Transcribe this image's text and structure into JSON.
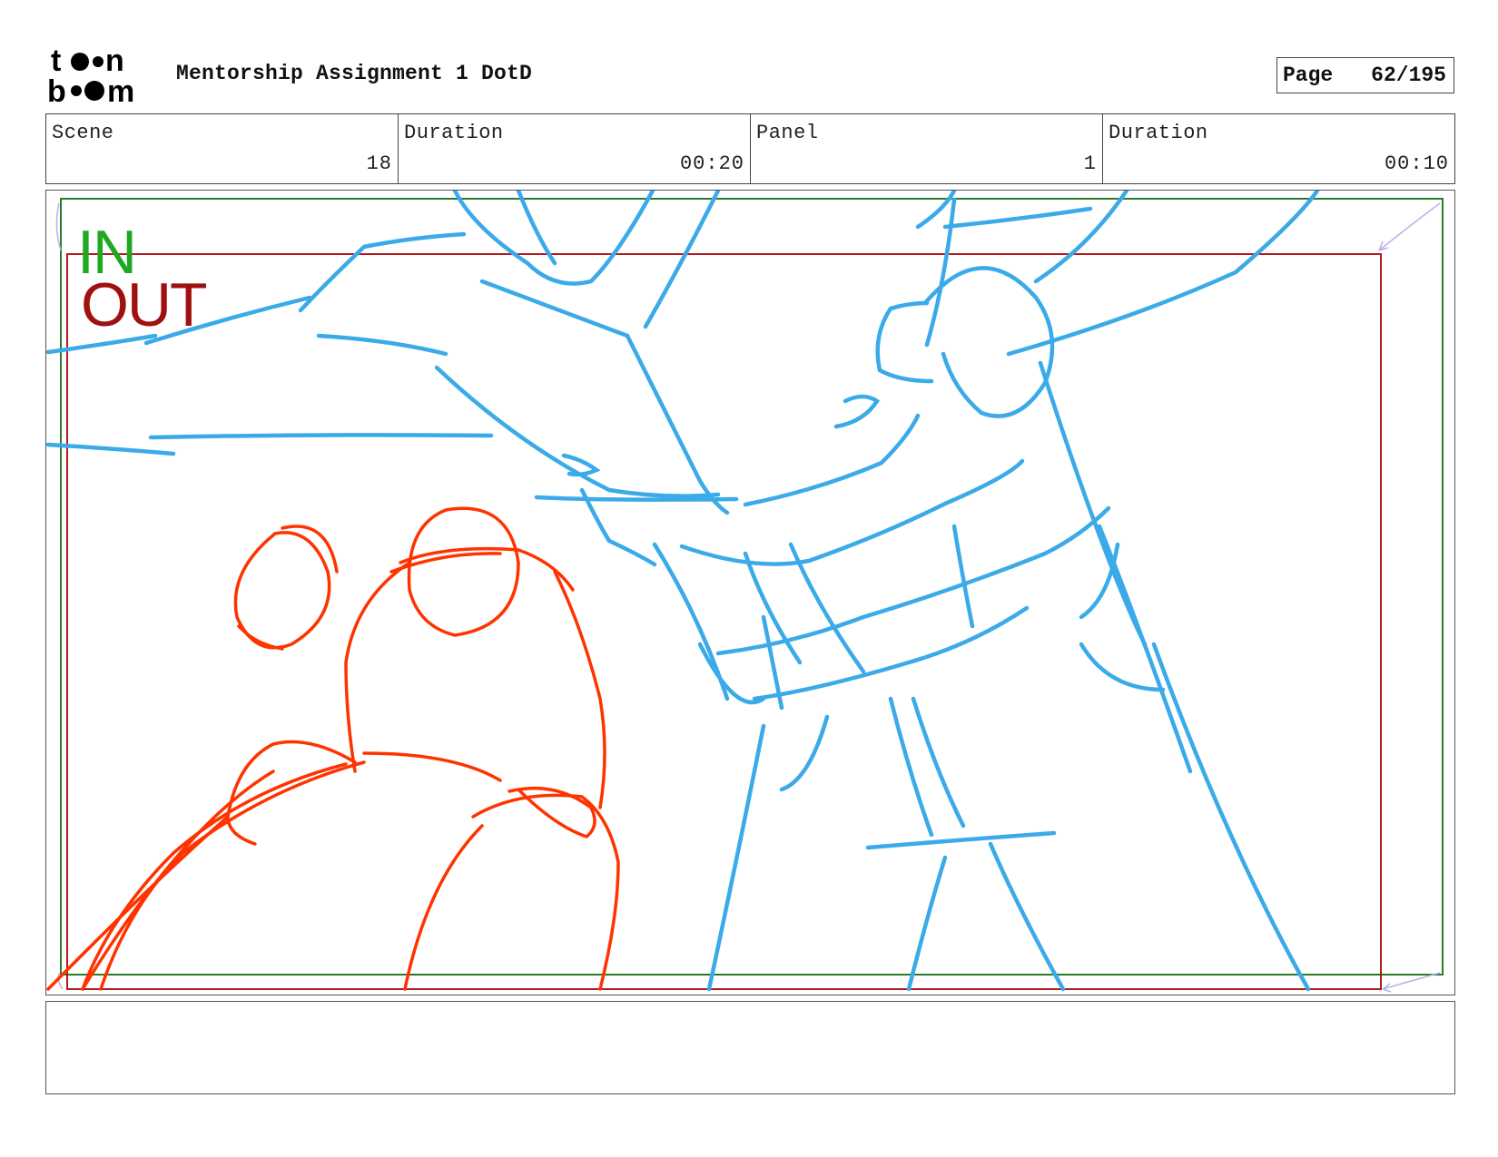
{
  "header": {
    "title": "Mentorship Assignment 1 DotD",
    "page_label": "Page",
    "page_value": "62/195"
  },
  "info": {
    "scene_label": "Scene",
    "scene_value": "18",
    "scene_duration_label": "Duration",
    "scene_duration_value": "00:20",
    "panel_label": "Panel",
    "panel_value": "1",
    "panel_duration_label": "Duration",
    "panel_duration_value": "00:10"
  },
  "panel": {
    "in_label": "IN",
    "out_label": "OUT"
  },
  "notes": {
    "text": ""
  },
  "colors": {
    "in_frame": "#2a7a2a",
    "out_frame": "#b01c1c",
    "sketch_blue": "#3aaae8",
    "sketch_red": "#ff3300"
  }
}
